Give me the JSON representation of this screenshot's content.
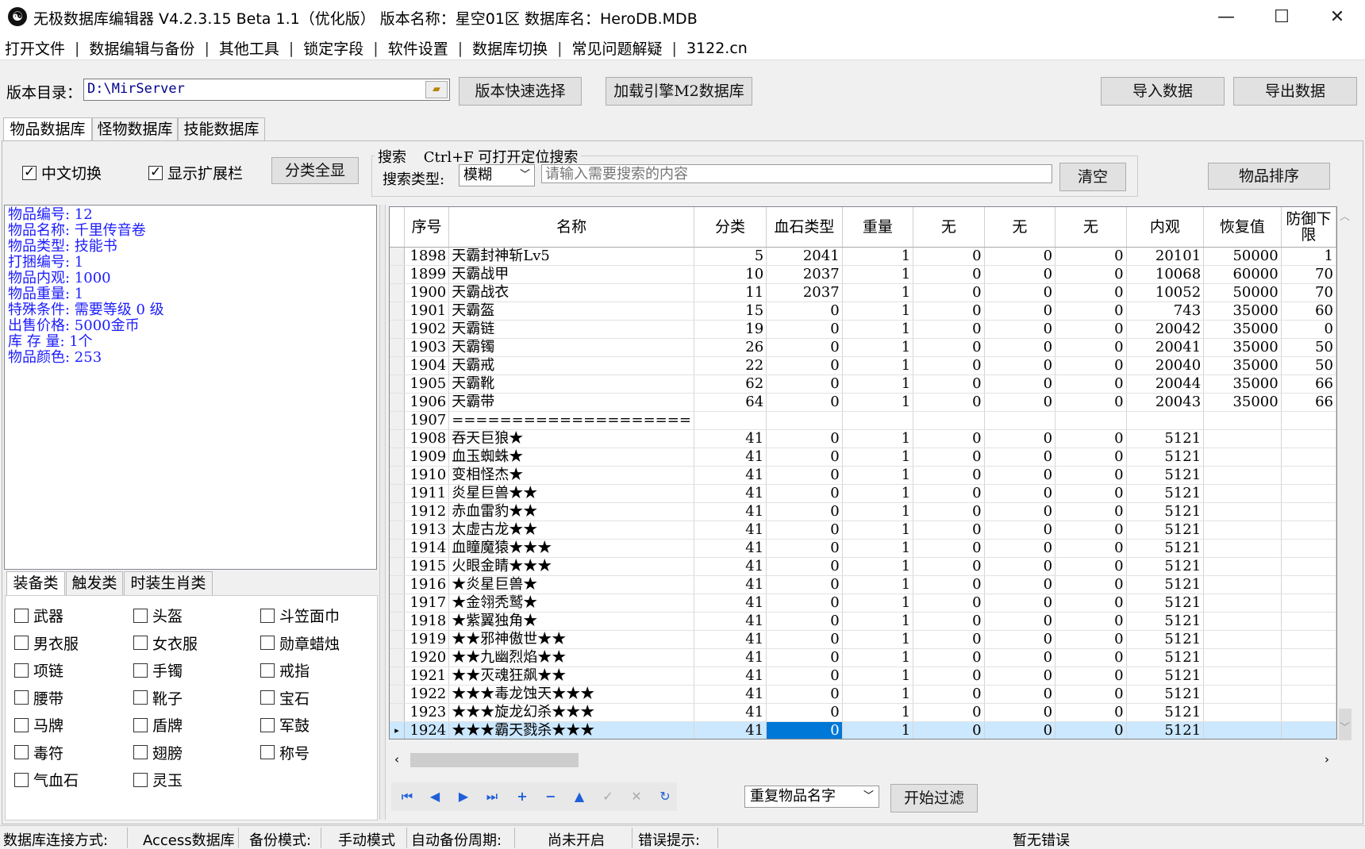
{
  "window": {
    "title": "无极数据库编辑器 V4.2.3.15    Beta 1.1（优化版）    版本名称：星空01区     数据库名：HeroDB.MDB",
    "minimize": "—",
    "maximize": "☐",
    "close": "✕"
  },
  "menu": [
    "打开文件",
    "数据编辑与备份",
    "其他工具",
    "锁定字段",
    "软件设置",
    "数据库切换",
    "常见问题解疑",
    "3122.cn"
  ],
  "toolbar": {
    "dir_label": "版本目录：",
    "dir_value": "D:\\MirServer",
    "quick_select": "版本快速选择",
    "load_m2": "加载引擎M2数据库",
    "import": "导入数据",
    "export": "导出数据"
  },
  "db_tabs": [
    "物品数据库",
    "怪物数据库",
    "技能数据库"
  ],
  "options": {
    "chinese_switch": "中文切换",
    "show_ext": "显示扩展栏",
    "show_all": "分类全显",
    "search_title": "搜索",
    "search_hint": "Ctrl+F 可打开定位搜索",
    "search_type_label": "搜索类型:",
    "search_type_value": "模糊",
    "search_placeholder": "请输入需要搜索的内容",
    "clear": "清空",
    "sort": "物品排序"
  },
  "info": [
    "物品编号: 12",
    "物品名称: 千里传音卷",
    "物品类型: 技能书",
    "打捆编号: 1",
    "物品内观: 1000",
    "物品重量: 1",
    "特殊条件: 需要等级 0 级",
    "出售价格: 5000金币",
    "库 存 量: 1个",
    "物品颜色: 253"
  ],
  "category_tabs": [
    "装备类",
    "触发类",
    "时装生肖类"
  ],
  "categories": [
    [
      "武器",
      "头盔",
      "斗笠面巾"
    ],
    [
      "男衣服",
      "女衣服",
      "勋章蜡烛"
    ],
    [
      "项链",
      "手镯",
      "戒指"
    ],
    [
      "腰带",
      "靴子",
      "宝石"
    ],
    [
      "马牌",
      "盾牌",
      "军鼓"
    ],
    [
      "毒符",
      "翅膀",
      "称号"
    ],
    [
      "气血石",
      "灵玉"
    ]
  ],
  "grid": {
    "columns": [
      "序号",
      "名称",
      "分类",
      "血石类型",
      "重量",
      "无",
      "无",
      "无",
      "内观",
      "恢复值",
      "防御下限"
    ],
    "rows": [
      [
        "1898",
        "天霸封神斩Lv5",
        "5",
        "2041",
        "1",
        "0",
        "0",
        "0",
        "20101",
        "50000",
        "1"
      ],
      [
        "1899",
        "天霸战甲",
        "10",
        "2037",
        "1",
        "0",
        "0",
        "0",
        "10068",
        "60000",
        "70"
      ],
      [
        "1900",
        "天霸战衣",
        "11",
        "2037",
        "1",
        "0",
        "0",
        "0",
        "10052",
        "50000",
        "70"
      ],
      [
        "1901",
        "天霸盔",
        "15",
        "0",
        "1",
        "0",
        "0",
        "0",
        "743",
        "35000",
        "60"
      ],
      [
        "1902",
        "天霸链",
        "19",
        "0",
        "1",
        "0",
        "0",
        "0",
        "20042",
        "35000",
        "0"
      ],
      [
        "1903",
        "天霸镯",
        "26",
        "0",
        "1",
        "0",
        "0",
        "0",
        "20041",
        "35000",
        "50"
      ],
      [
        "1904",
        "天霸戒",
        "22",
        "0",
        "1",
        "0",
        "0",
        "0",
        "20040",
        "35000",
        "50"
      ],
      [
        "1905",
        "天霸靴",
        "62",
        "0",
        "1",
        "0",
        "0",
        "0",
        "20044",
        "35000",
        "66"
      ],
      [
        "1906",
        "天霸带",
        "64",
        "0",
        "1",
        "0",
        "0",
        "0",
        "20043",
        "35000",
        "66"
      ],
      [
        "1907",
        "====================",
        "",
        "",
        "",
        "",
        "",
        "",
        "",
        "",
        ""
      ],
      [
        "1908",
        "吞天巨狼★",
        "41",
        "0",
        "1",
        "0",
        "0",
        "0",
        "5121",
        "",
        ""
      ],
      [
        "1909",
        "血玉蜘蛛★",
        "41",
        "0",
        "1",
        "0",
        "0",
        "0",
        "5121",
        "",
        ""
      ],
      [
        "1910",
        "变相怪杰★",
        "41",
        "0",
        "1",
        "0",
        "0",
        "0",
        "5121",
        "",
        ""
      ],
      [
        "1911",
        "炎星巨兽★★",
        "41",
        "0",
        "1",
        "0",
        "0",
        "0",
        "5121",
        "",
        ""
      ],
      [
        "1912",
        "赤血雷豹★★",
        "41",
        "0",
        "1",
        "0",
        "0",
        "0",
        "5121",
        "",
        ""
      ],
      [
        "1913",
        "太虚古龙★★",
        "41",
        "0",
        "1",
        "0",
        "0",
        "0",
        "5121",
        "",
        ""
      ],
      [
        "1914",
        "血瞳魔猿★★★",
        "41",
        "0",
        "1",
        "0",
        "0",
        "0",
        "5121",
        "",
        ""
      ],
      [
        "1915",
        "火眼金睛★★★",
        "41",
        "0",
        "1",
        "0",
        "0",
        "0",
        "5121",
        "",
        ""
      ],
      [
        "1916",
        "★炎星巨兽★",
        "41",
        "0",
        "1",
        "0",
        "0",
        "0",
        "5121",
        "",
        ""
      ],
      [
        "1917",
        "★金翎秃鹫★",
        "41",
        "0",
        "1",
        "0",
        "0",
        "0",
        "5121",
        "",
        ""
      ],
      [
        "1918",
        "★紫翼独角★",
        "41",
        "0",
        "1",
        "0",
        "0",
        "0",
        "5121",
        "",
        ""
      ],
      [
        "1919",
        "★★邪神傲世★★",
        "41",
        "0",
        "1",
        "0",
        "0",
        "0",
        "5121",
        "",
        ""
      ],
      [
        "1920",
        "★★九幽烈焰★★",
        "41",
        "0",
        "1",
        "0",
        "0",
        "0",
        "5121",
        "",
        ""
      ],
      [
        "1921",
        "★★灭魂狂飙★★",
        "41",
        "0",
        "1",
        "0",
        "0",
        "0",
        "5121",
        "",
        ""
      ],
      [
        "1922",
        "★★★毒龙蚀天★★★",
        "41",
        "0",
        "1",
        "0",
        "0",
        "0",
        "5121",
        "",
        ""
      ],
      [
        "1923",
        "★★★旋龙幻杀★★★",
        "41",
        "0",
        "1",
        "0",
        "0",
        "0",
        "5121",
        "",
        ""
      ],
      [
        "1924",
        "★★★霸天戮杀★★★",
        "41",
        "0",
        "1",
        "0",
        "0",
        "0",
        "5121",
        "",
        ""
      ]
    ]
  },
  "bottom": {
    "filter_select": "重复物品名字",
    "start_filter": "开始过滤"
  },
  "status": {
    "conn_label": "数据库连接方式:",
    "conn_value": "Access数据库",
    "backup_label": "备份模式:",
    "backup_value": "手动模式",
    "auto_label": "自动备份周期:",
    "auto_value": "尚未开启",
    "err_label": "错误提示:",
    "err_value": "暂无错误"
  }
}
